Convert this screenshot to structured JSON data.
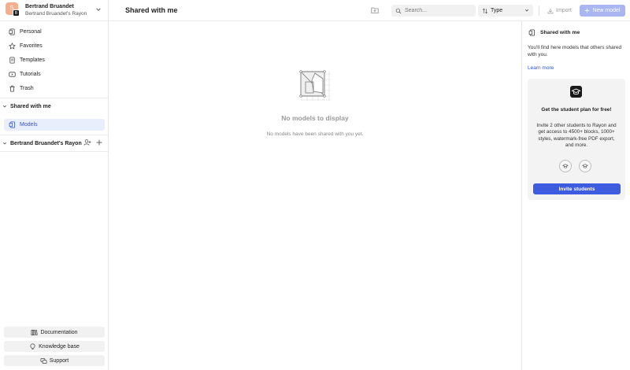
{
  "account": {
    "avatar_letter": "S",
    "badge_letter": "B",
    "name": "Bertrand Bruandet",
    "workspace": "Bertrand Bruandet's Rayon"
  },
  "nav": {
    "items": [
      {
        "label": "Personal",
        "icon": "personal-icon"
      },
      {
        "label": "Favorites",
        "icon": "star-icon"
      },
      {
        "label": "Templates",
        "icon": "templates-icon"
      },
      {
        "label": "Tutorials",
        "icon": "video-icon"
      },
      {
        "label": "Trash",
        "icon": "trash-icon"
      }
    ]
  },
  "sections": {
    "shared": {
      "label": "Shared with me",
      "models_label": "Models"
    },
    "workspace": {
      "label": "Bertrand Bruandet's Rayon"
    }
  },
  "bottom": {
    "documentation": "Documentation",
    "knowledge_base": "Knowledge base",
    "support": "Support"
  },
  "topbar": {
    "title": "Shared with me",
    "search_placeholder": "Search...",
    "type_label": "Type",
    "import_label": "Import",
    "new_model_label": "New model"
  },
  "empty": {
    "title": "No models to display",
    "subtitle": "No models have been shared with you yet."
  },
  "panel": {
    "title": "Shared with me",
    "description": "You'll find here models that others shared with you.",
    "learn_more": "Learn more",
    "promo": {
      "title": "Get the student plan for free!",
      "body": "Invite 2 other students to Rayon and get access to 4500+ blocks, 1000+ styles, watermark-free PDF export, and more.",
      "button": "Invite students"
    }
  },
  "colors": {
    "accent": "#3d5ce0",
    "accent_disabled": "#a9b6f2",
    "selected_bg": "#e8eefc",
    "avatar": "#f4b08e"
  }
}
